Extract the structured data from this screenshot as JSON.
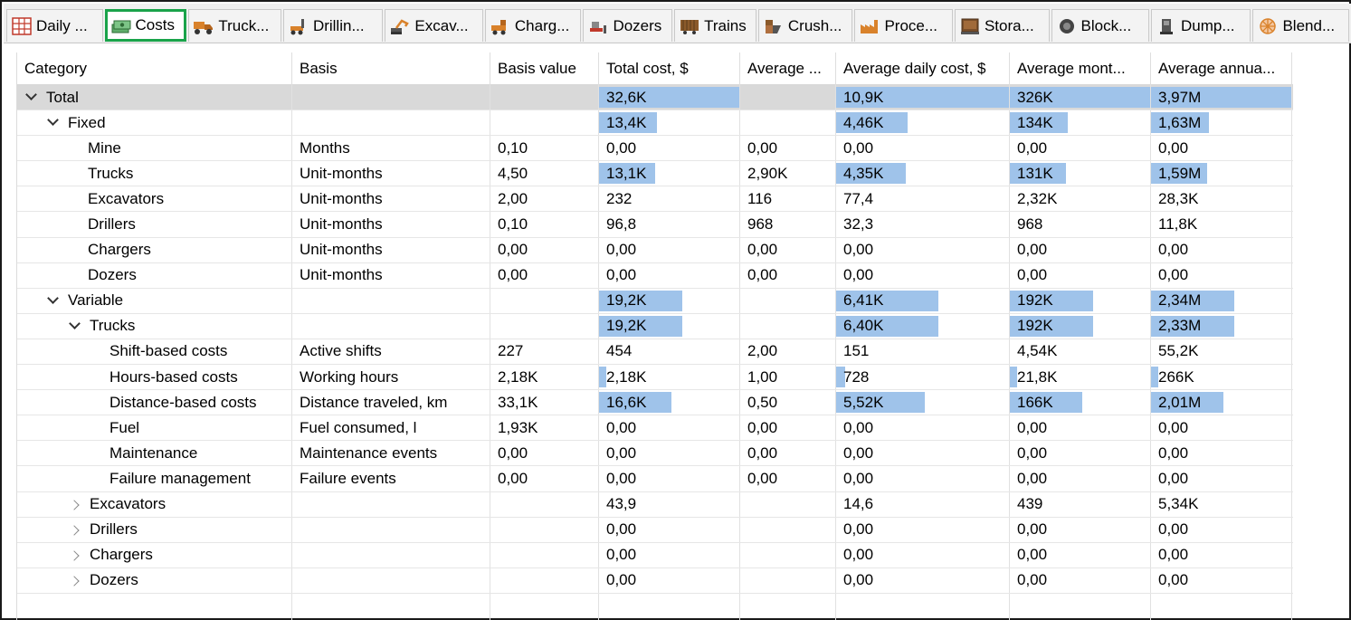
{
  "tabs": [
    {
      "label": "Daily ...",
      "icon": "calendar-grid-icon",
      "active": false
    },
    {
      "label": "Costs",
      "icon": "money-icon",
      "active": true
    },
    {
      "label": "Truck...",
      "icon": "truck-icon",
      "active": false
    },
    {
      "label": "Drillin...",
      "icon": "drill-icon",
      "active": false
    },
    {
      "label": "Excav...",
      "icon": "excavator-icon",
      "active": false
    },
    {
      "label": "Charg...",
      "icon": "charger-icon",
      "active": false
    },
    {
      "label": "Dozers",
      "icon": "dozer-icon",
      "active": false
    },
    {
      "label": "Trains",
      "icon": "train-icon",
      "active": false
    },
    {
      "label": "Crush...",
      "icon": "crusher-icon",
      "active": false
    },
    {
      "label": "Proce...",
      "icon": "factory-icon",
      "active": false
    },
    {
      "label": "Stora...",
      "icon": "storage-icon",
      "active": false
    },
    {
      "label": "Block...",
      "icon": "block-icon",
      "active": false
    },
    {
      "label": "Dump...",
      "icon": "dump-icon",
      "active": false
    },
    {
      "label": "Blend...",
      "icon": "blend-icon",
      "active": false
    }
  ],
  "columns": [
    "Category",
    "Basis",
    "Basis value",
    "Total cost, $",
    "Average ...",
    "Average daily cost, $",
    "Average mont...",
    "Average annua..."
  ],
  "rows": [
    {
      "level": 0,
      "expander": "open",
      "category": "Total",
      "basis": "",
      "basis_value": "",
      "total": "32,6K",
      "avg": "",
      "daily": "10,9K",
      "monthly": "326K",
      "annual": "3,97M",
      "bars": [
        1.0,
        1.0,
        1.0,
        1.0
      ]
    },
    {
      "level": 1,
      "expander": "open",
      "category": "Fixed",
      "basis": "",
      "basis_value": "",
      "total": "13,4K",
      "avg": "",
      "daily": "4,46K",
      "monthly": "134K",
      "annual": "1,63M",
      "bars": [
        0.41,
        0.41,
        0.41,
        0.41
      ]
    },
    {
      "level": 2,
      "expander": "none",
      "category": "Mine",
      "basis": "Months",
      "basis_value": "0,10",
      "total": "0,00",
      "avg": "0,00",
      "daily": "0,00",
      "monthly": "0,00",
      "annual": "0,00",
      "bars": [
        0,
        0,
        0,
        0
      ]
    },
    {
      "level": 2,
      "expander": "none",
      "category": "Trucks",
      "basis": "Unit-months",
      "basis_value": "4,50",
      "total": "13,1K",
      "avg": "2,90K",
      "daily": "4,35K",
      "monthly": "131K",
      "annual": "1,59M",
      "bars": [
        0.4,
        0.4,
        0.4,
        0.4
      ]
    },
    {
      "level": 2,
      "expander": "none",
      "category": "Excavators",
      "basis": "Unit-months",
      "basis_value": "2,00",
      "total": "232",
      "avg": "116",
      "daily": "77,4",
      "monthly": "2,32K",
      "annual": "28,3K",
      "bars": [
        0,
        0,
        0,
        0
      ]
    },
    {
      "level": 2,
      "expander": "none",
      "category": "Drillers",
      "basis": "Unit-months",
      "basis_value": "0,10",
      "total": "96,8",
      "avg": "968",
      "daily": "32,3",
      "monthly": "968",
      "annual": "11,8K",
      "bars": [
        0,
        0,
        0,
        0
      ]
    },
    {
      "level": 2,
      "expander": "none",
      "category": "Chargers",
      "basis": "Unit-months",
      "basis_value": "0,00",
      "total": "0,00",
      "avg": "0,00",
      "daily": "0,00",
      "monthly": "0,00",
      "annual": "0,00",
      "bars": [
        0,
        0,
        0,
        0
      ]
    },
    {
      "level": 2,
      "expander": "none",
      "category": "Dozers",
      "basis": "Unit-months",
      "basis_value": "0,00",
      "total": "0,00",
      "avg": "0,00",
      "daily": "0,00",
      "monthly": "0,00",
      "annual": "0,00",
      "bars": [
        0,
        0,
        0,
        0
      ]
    },
    {
      "level": 1,
      "expander": "open",
      "category": "Variable",
      "basis": "",
      "basis_value": "",
      "total": "19,2K",
      "avg": "",
      "daily": "6,41K",
      "monthly": "192K",
      "annual": "2,34M",
      "bars": [
        0.59,
        0.59,
        0.59,
        0.59
      ]
    },
    {
      "level": 2,
      "expander": "open",
      "category": "Trucks",
      "basis": "",
      "basis_value": "",
      "total": "19,2K",
      "avg": "",
      "daily": "6,40K",
      "monthly": "192K",
      "annual": "2,33M",
      "bars": [
        0.59,
        0.59,
        0.59,
        0.59
      ]
    },
    {
      "level": 3,
      "expander": "none",
      "category": "Shift-based costs",
      "basis": "Active shifts",
      "basis_value": "227",
      "total": "454",
      "avg": "2,00",
      "daily": "151",
      "monthly": "4,54K",
      "annual": "55,2K",
      "bars": [
        0,
        0,
        0,
        0
      ]
    },
    {
      "level": 3,
      "expander": "none",
      "category": "Hours-based costs",
      "basis": "Working hours",
      "basis_value": "2,18K",
      "total": "2,18K",
      "avg": "1,00",
      "daily": "728",
      "monthly": "21,8K",
      "annual": "266K",
      "bars": [
        0.05,
        0.05,
        0.05,
        0.05
      ]
    },
    {
      "level": 3,
      "expander": "none",
      "category": "Distance-based costs",
      "basis": "Distance traveled, km",
      "basis_value": "33,1K",
      "total": "16,6K",
      "avg": "0,50",
      "daily": "5,52K",
      "monthly": "166K",
      "annual": "2,01M",
      "bars": [
        0.51,
        0.51,
        0.51,
        0.51
      ]
    },
    {
      "level": 3,
      "expander": "none",
      "category": "Fuel",
      "basis": "Fuel consumed, l",
      "basis_value": "1,93K",
      "total": "0,00",
      "avg": "0,00",
      "daily": "0,00",
      "monthly": "0,00",
      "annual": "0,00",
      "bars": [
        0,
        0,
        0,
        0
      ]
    },
    {
      "level": 3,
      "expander": "none",
      "category": "Maintenance",
      "basis": "Maintenance events",
      "basis_value": "0,00",
      "total": "0,00",
      "avg": "0,00",
      "daily": "0,00",
      "monthly": "0,00",
      "annual": "0,00",
      "bars": [
        0,
        0,
        0,
        0
      ]
    },
    {
      "level": 3,
      "expander": "none",
      "category": "Failure management",
      "basis": "Failure events",
      "basis_value": "0,00",
      "total": "0,00",
      "avg": "0,00",
      "daily": "0,00",
      "monthly": "0,00",
      "annual": "0,00",
      "bars": [
        0,
        0,
        0,
        0
      ]
    },
    {
      "level": 2,
      "expander": "closed",
      "category": "Excavators",
      "basis": "",
      "basis_value": "",
      "total": "43,9",
      "avg": "",
      "daily": "14,6",
      "monthly": "439",
      "annual": "5,34K",
      "bars": [
        0,
        0,
        0,
        0
      ]
    },
    {
      "level": 2,
      "expander": "closed",
      "category": "Drillers",
      "basis": "",
      "basis_value": "",
      "total": "0,00",
      "avg": "",
      "daily": "0,00",
      "monthly": "0,00",
      "annual": "0,00",
      "bars": [
        0,
        0,
        0,
        0
      ]
    },
    {
      "level": 2,
      "expander": "closed",
      "category": "Chargers",
      "basis": "",
      "basis_value": "",
      "total": "0,00",
      "avg": "",
      "daily": "0,00",
      "monthly": "0,00",
      "annual": "0,00",
      "bars": [
        0,
        0,
        0,
        0
      ]
    },
    {
      "level": 2,
      "expander": "closed",
      "category": "Dozers",
      "basis": "",
      "basis_value": "",
      "total": "0,00",
      "avg": "",
      "daily": "0,00",
      "monthly": "0,00",
      "annual": "0,00",
      "bars": [
        0,
        0,
        0,
        0
      ]
    }
  ],
  "colors": {
    "bar": "#9fc3ea",
    "selected_row": "#d9d9d9",
    "active_tab_border": "#1aa34a"
  }
}
